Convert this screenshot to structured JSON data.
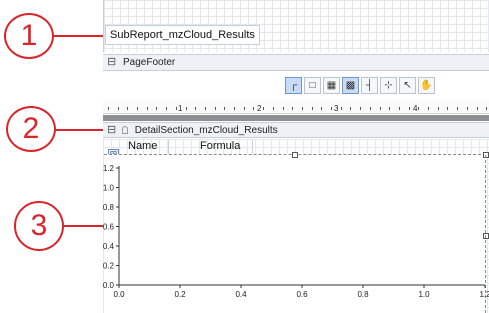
{
  "callouts": [
    "1",
    "2",
    "3"
  ],
  "subreport": {
    "title": "SubReport_mzCloud_Results"
  },
  "page_footer": {
    "collapse_symbol": "⊟",
    "label": "PageFooter"
  },
  "toolbar": {
    "buttons": [
      {
        "icon": "connector-icon",
        "glyph": "┌",
        "active": true
      },
      {
        "icon": "rectangle-icon",
        "glyph": "□",
        "active": false
      },
      {
        "icon": "table-icon",
        "glyph": "▦",
        "active": false
      },
      {
        "icon": "grid-icon",
        "glyph": "▩",
        "active": true
      },
      {
        "icon": "snap-lines-icon",
        "glyph": "┤",
        "active": false
      },
      {
        "icon": "snap-grid-icon",
        "glyph": "⊹",
        "active": false
      },
      {
        "icon": "pointer-icon",
        "glyph": "↖",
        "active": false
      },
      {
        "icon": "hand-icon",
        "glyph": "✋",
        "active": false
      }
    ]
  },
  "ruler": {
    "labels": [
      "1",
      "2",
      "3",
      "4"
    ]
  },
  "detail_section": {
    "collapse_symbol": "⊟",
    "label": "DetailSection_mzCloud_Results",
    "move_handle": "⊞",
    "columns": [
      "Name",
      "Formula"
    ]
  },
  "chart_data": {
    "type": "line",
    "x": [],
    "y": [],
    "xlim": [
      0,
      1.2
    ],
    "ylim": [
      0,
      1.2
    ],
    "x_ticks": [
      "0.0",
      "0.2",
      "0.4",
      "0.6",
      "0.8",
      "1.0",
      "1.2"
    ],
    "y_ticks": [
      "1.2",
      "1.0",
      "0.8",
      "0.6",
      "0.4",
      "0.2",
      "0.0"
    ],
    "grid": false
  },
  "colors": {
    "callout": "#d9252a",
    "header_bg": "#eef1f6",
    "gray_bar": "#8c9095"
  }
}
